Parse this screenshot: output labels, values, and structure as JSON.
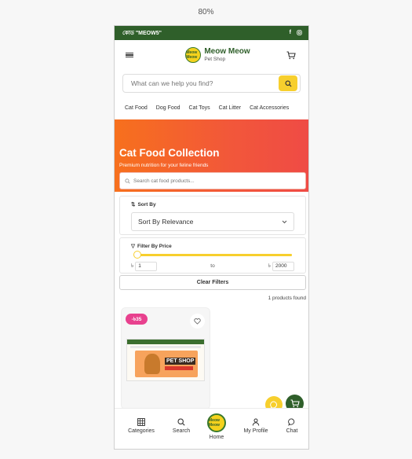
{
  "browser": {
    "zoom": "80%"
  },
  "promo": {
    "text": "কোড \"MEOW5\"",
    "icons": [
      "facebook-icon",
      "instagram-icon"
    ]
  },
  "header": {
    "brand_name": "Meow Meow",
    "brand_sub": "Pet Shop",
    "logo_text": "Meow Meow"
  },
  "search": {
    "placeholder": "What can we help you find?"
  },
  "categories": [
    "Cat Food",
    "Dog Food",
    "Cat Toys",
    "Cat Litter",
    "Cat Accessories"
  ],
  "hero": {
    "title": "Cat Food Collection",
    "subtitle": "Premium nutrition for your feline friends",
    "search_placeholder": "Search cat food products..."
  },
  "sort": {
    "label": "Sort By",
    "selected": "Sort By Relevance"
  },
  "price_filter": {
    "label": "Filter By Price",
    "currency": "৳",
    "min": "1",
    "to_label": "to",
    "max": "2000",
    "range_fraction": [
      0.0,
      1.0
    ]
  },
  "clear_filters": "Clear Filters",
  "results": {
    "count_text": "1 products found"
  },
  "product": {
    "discount": "-৳35",
    "image_text": "PET SHOP"
  },
  "bottom_nav": {
    "categories": "Categories",
    "search": "Search",
    "home": "Home",
    "profile": "My Profile",
    "chat": "Chat"
  },
  "colors": {
    "brand_green": "#2f5f2a",
    "accent_yellow": "#f7cf2d",
    "hero_start": "#f7701d",
    "hero_end": "#ef4b45",
    "discount_pink": "#e8418e"
  }
}
